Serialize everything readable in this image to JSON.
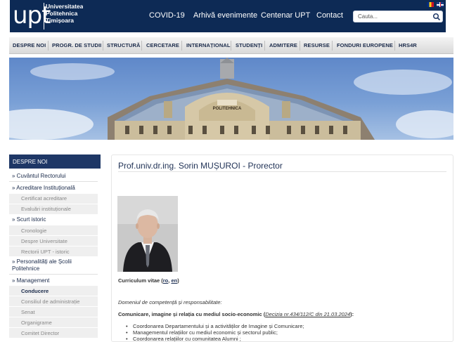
{
  "header": {
    "logo_abbr": "UPT",
    "logo_line1": "Universitatea",
    "logo_line2": "Politehnica",
    "logo_line3": "Timișoara",
    "nav": [
      "COVID-19",
      "Arhivă evenimente",
      "Centenar UPT",
      "Contact"
    ],
    "search_placeholder": "Cauta...",
    "languages": [
      "RO",
      "EN"
    ]
  },
  "main_menu": {
    "items": [
      "DESPRE NOI",
      "PROGR. DE STUDII",
      "STRUCTURĂ",
      "CERCETARE",
      "INTERNAȚIONAL",
      "STUDENȚI",
      "ADMITERE",
      "RESURSE",
      "FONDURI EUROPENE",
      "HRS4R"
    ]
  },
  "banner": {
    "building_label": "POLITEHNICA"
  },
  "sidebar": {
    "heading": "DESPRE NOI",
    "items": [
      {
        "label": "» Cuvântul Rectorului",
        "level": 1
      },
      {
        "label": "» Acreditare Instituțională",
        "level": 1
      },
      {
        "label": "Certificat acreditare",
        "level": 2
      },
      {
        "label": "Evaluări instituționale",
        "level": 2
      },
      {
        "label": "» Scurt istoric",
        "level": 1
      },
      {
        "label": "Cronologie",
        "level": 2
      },
      {
        "label": "Despre Universitate",
        "level": 2
      },
      {
        "label": "Rectorii UPT - istoric",
        "level": 2
      },
      {
        "label": "» Personalități ale Școlii Politehnice",
        "level": 1
      },
      {
        "label": "» Management",
        "level": 1
      },
      {
        "label": "Conducere",
        "level": 2,
        "active": true
      },
      {
        "label": "Consiliul de administrație",
        "level": 2
      },
      {
        "label": "Senat",
        "level": 2
      },
      {
        "label": "Organigrame",
        "level": 2
      },
      {
        "label": "Comitet Director",
        "level": 2
      }
    ]
  },
  "content": {
    "title": "Prof.univ.dr.ing. Sorin MUȘUROI - Prorector",
    "cv_label": "Curriculum vitae (",
    "cv_ro": "ro",
    "cv_comma": ", ",
    "cv_en": "en",
    "cv_end": ")",
    "competence_intro": "Domeniul de competență și responsabilitate:",
    "area_title": "Comunicare, imagine și relația cu mediul socio-economic",
    "decision": "Decizia nr.434/112/C din 21.03.2024",
    "area_open": "(",
    "area_close": "):",
    "responsibilities": [
      "Coordonarea Departamentului și a activităților de Imagine și Comunicare;",
      "Managementul relațiilor cu mediul economic și sectorul public;",
      "Coordonarea relațiilor cu comunitatea Alumni ;"
    ]
  },
  "colors": {
    "header_navy": "#0d2a55",
    "sidebar_head": "#1e3766",
    "title_blue": "#1f3155"
  }
}
